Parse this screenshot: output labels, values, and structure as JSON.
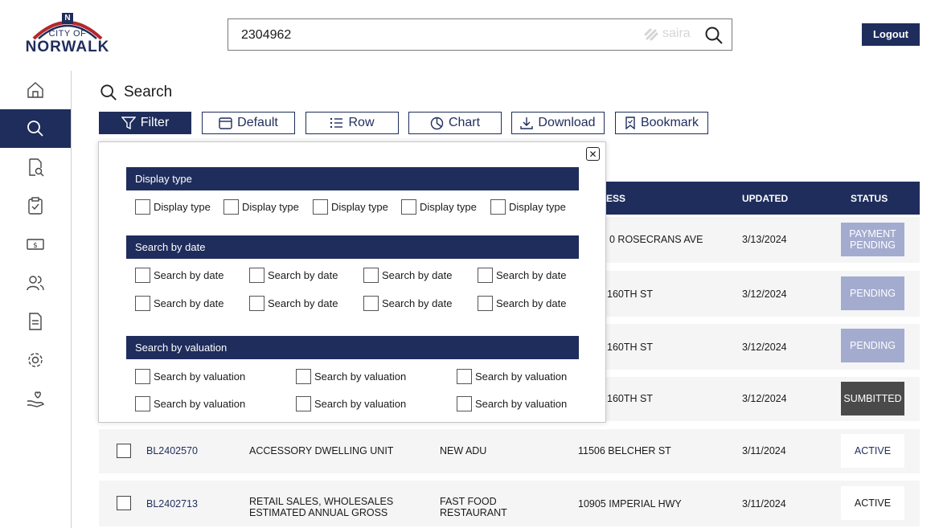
{
  "logo": {
    "city_of": "CITY OF",
    "name": "NORWALK",
    "badge_letter": "N"
  },
  "search": {
    "value": "2304962",
    "brand": "saira"
  },
  "header": {
    "logout_label": "Logout"
  },
  "sidebar": {
    "items": [
      {
        "icon": "home-icon"
      },
      {
        "icon": "search-icon",
        "active": true
      },
      {
        "icon": "document-search-icon"
      },
      {
        "icon": "clipboard-check-icon"
      },
      {
        "icon": "money-icon"
      },
      {
        "icon": "users-icon"
      },
      {
        "icon": "file-icon"
      },
      {
        "icon": "gear-icon"
      },
      {
        "icon": "hand-heart-icon"
      }
    ]
  },
  "page": {
    "title": "Search"
  },
  "toolbar": {
    "filter": "Filter",
    "default": "Default",
    "row": "Row",
    "chart": "Chart",
    "download": "Download",
    "bookmark": "Bookmark"
  },
  "table": {
    "headers": {
      "address_partial": "ESS",
      "updated": "UPDATED",
      "status": "STATUS"
    },
    "rows": [
      {
        "address": "0 ROSECRANS AVE",
        "updated": "3/13/2024",
        "status": "PAYMENT PENDING"
      },
      {
        "address": "160TH ST",
        "updated": "3/12/2024",
        "status": "PENDING"
      },
      {
        "address": "160TH ST",
        "updated": "3/12/2024",
        "status": "PENDING"
      },
      {
        "address": "160TH ST",
        "updated": "3/12/2024",
        "status": "SUMBITTED"
      },
      {
        "id": "BL2402570",
        "description": "ACCESSORY DWELLING UNIT",
        "type": "NEW ADU",
        "address": "11506 BELCHER ST",
        "updated": "3/11/2024",
        "status": "ACTIVE"
      },
      {
        "id": "BL2402713",
        "description_1": "RETAIL SALES, WHOLESALES",
        "description_2": "ESTIMATED ANNUAL GROSS",
        "type_1": "FAST FOOD",
        "type_2": "RESTAURANT",
        "address": "10905 IMPERIAL HWY",
        "updated": "3/11/2024",
        "status": "ACTIVE"
      }
    ]
  },
  "filter_panel": {
    "display_type": {
      "title": "Display type",
      "options": [
        "Display type",
        "Display type",
        "Display type",
        "Display type",
        "Display type"
      ]
    },
    "search_by_date": {
      "title": "Search by date",
      "options": [
        "Search by date",
        "Search by date",
        "Search by date",
        "Search by date",
        "Search by date",
        "Search by date",
        "Search by date",
        "Search by date"
      ]
    },
    "search_by_valuation": {
      "title": "Search by valuation",
      "options": [
        "Search by valuation",
        "Search by valuation",
        "Search by valuation",
        "Search by valuation",
        "Search by valuation",
        "Search by valuation"
      ]
    }
  },
  "colors": {
    "navy": "#1f2d5c",
    "pending": "#a3abcf",
    "submitted": "#4a4a4a",
    "row_bg": "#f5f5f5"
  }
}
